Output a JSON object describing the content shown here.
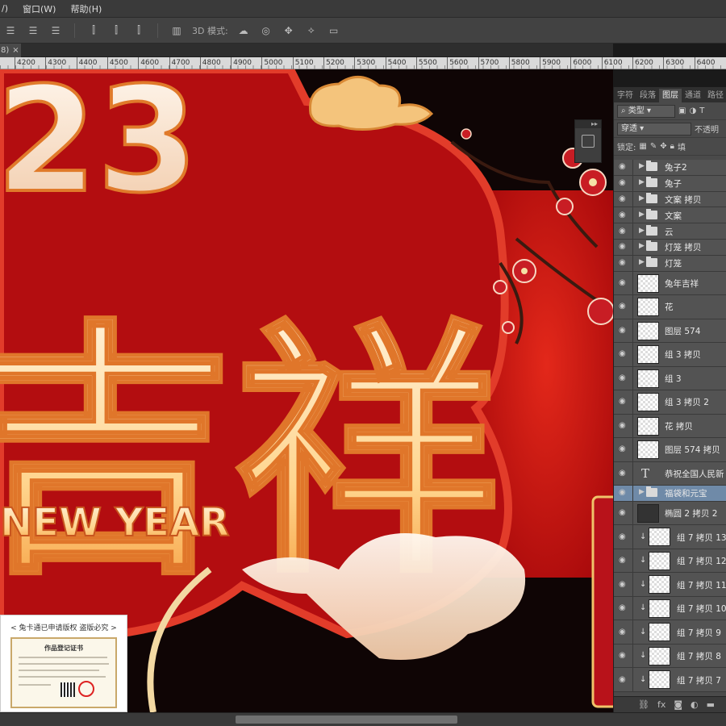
{
  "menu": {
    "items": [
      "/)",
      "窗口(W)",
      "帮助(H)"
    ]
  },
  "options_bar": {
    "mode_3d_label": "3D 模式:"
  },
  "document": {
    "tab_label": "8)",
    "tab_close": "×"
  },
  "ruler": {
    "ticks": [
      "4200",
      "4300",
      "4400",
      "4500",
      "4600",
      "4700",
      "4800",
      "4900",
      "5000",
      "5100",
      "5200",
      "5300",
      "5400",
      "5500",
      "5600",
      "5700",
      "5800",
      "5900",
      "6000",
      "6100",
      "6200",
      "6300",
      "6400"
    ]
  },
  "artwork": {
    "big_number": "23",
    "title_chars": "吉祥",
    "subtitle": "NEW YEAR"
  },
  "dock": {
    "collapse": "▸▸",
    "close": "×"
  },
  "layers_panel": {
    "tabs": [
      "字符",
      "段落",
      "图层",
      "通道",
      "路径"
    ],
    "active_tab": "图层",
    "filter_kind": "类型",
    "blend_mode": "穿透",
    "opacity_label": "不透明",
    "lock_label": "锁定:",
    "fill_label": "填",
    "layers": [
      {
        "name": "兔子2",
        "kind": "group",
        "selected": false
      },
      {
        "name": "兔子",
        "kind": "group",
        "selected": false
      },
      {
        "name": "文案 拷贝",
        "kind": "group",
        "selected": false
      },
      {
        "name": "文案",
        "kind": "group",
        "selected": false
      },
      {
        "name": "云",
        "kind": "group",
        "selected": false
      },
      {
        "name": "灯笼 拷贝",
        "kind": "group",
        "selected": false
      },
      {
        "name": "灯笼",
        "kind": "group",
        "selected": false
      },
      {
        "name": "兔年吉祥",
        "kind": "pixel",
        "selected": false
      },
      {
        "name": "花",
        "kind": "pixel",
        "selected": false
      },
      {
        "name": "图层 574",
        "kind": "pixel",
        "selected": false
      },
      {
        "name": "组 3 拷贝",
        "kind": "pixel",
        "selected": false
      },
      {
        "name": "组 3",
        "kind": "pixel",
        "selected": false
      },
      {
        "name": "组 3 拷贝 2",
        "kind": "pixel",
        "selected": false
      },
      {
        "name": "花 拷贝",
        "kind": "pixel",
        "selected": false
      },
      {
        "name": "图层 574 拷贝",
        "kind": "pixel",
        "selected": false
      },
      {
        "name": "恭祝全国人民新",
        "kind": "text",
        "selected": false
      },
      {
        "name": "福袋和元宝",
        "kind": "group",
        "selected": true
      },
      {
        "name": "椭圆 2 拷贝 2",
        "kind": "shape",
        "selected": false
      },
      {
        "name": "组 7 拷贝 13",
        "kind": "clipped",
        "selected": false
      },
      {
        "name": "组 7 拷贝 12",
        "kind": "clipped",
        "selected": false
      },
      {
        "name": "组 7 拷贝 11",
        "kind": "clipped",
        "selected": false
      },
      {
        "name": "组 7 拷贝 10",
        "kind": "clipped",
        "selected": false
      },
      {
        "name": "组 7 拷贝 9",
        "kind": "clipped",
        "selected": false
      },
      {
        "name": "组 7 拷贝 8",
        "kind": "clipped",
        "selected": false
      },
      {
        "name": "组 7 拷贝 7",
        "kind": "clipped",
        "selected": false
      }
    ],
    "footer_icons": [
      "link-icon",
      "fx-icon",
      "mask-icon",
      "adjust-icon",
      "folder-icon"
    ]
  },
  "certificate": {
    "caption": "< 兔卡通已申请版权 盗版必究 >",
    "title": "作品登记证书"
  }
}
